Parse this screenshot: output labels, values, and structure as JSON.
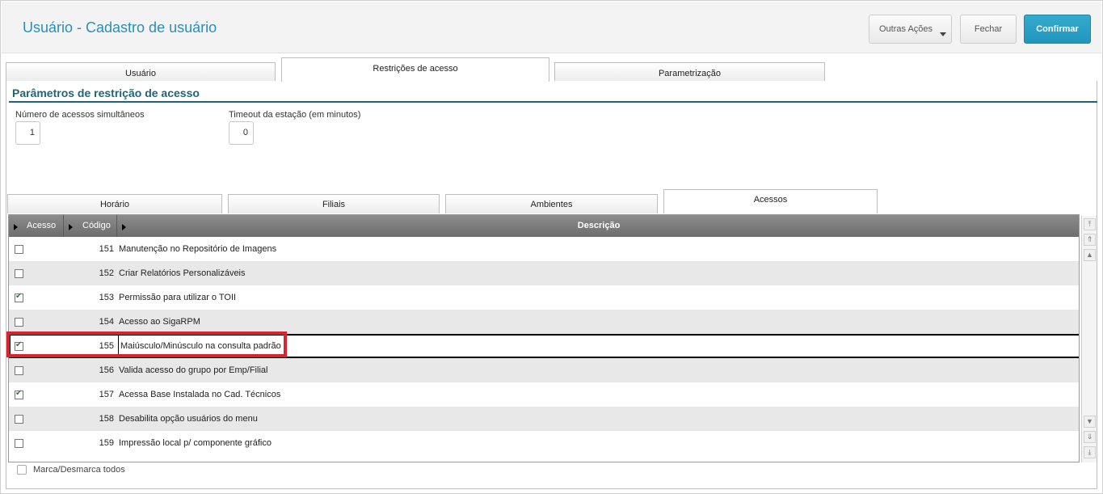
{
  "header": {
    "title": "Usuário - Cadastro de usuário",
    "btn_outras": "Outras Ações",
    "btn_fechar": "Fechar",
    "btn_confirmar": "Confirmar",
    "accent_color": "#2b8fb8"
  },
  "tabs": [
    {
      "label": "Usuário",
      "active": false
    },
    {
      "label": "Restrições de acesso",
      "active": true
    },
    {
      "label": "Parametrização",
      "active": false
    }
  ],
  "section": {
    "title": "Parâmetros de restrição de acesso",
    "fields": [
      {
        "label": "Número de acessos simultâneos",
        "value": "1"
      },
      {
        "label": "Timeout da estação (em minutos)",
        "value": "0"
      }
    ]
  },
  "subtabs": [
    {
      "label": "Horário",
      "active": false
    },
    {
      "label": "Filiais",
      "active": false
    },
    {
      "label": "Ambientes",
      "active": false
    },
    {
      "label": "Acessos",
      "active": true
    }
  ],
  "grid": {
    "columns": [
      "Acesso",
      "Código",
      "Descrição"
    ],
    "rows": [
      {
        "checked": false,
        "code": "151",
        "desc": "Manutenção no Repositório de Imagens"
      },
      {
        "checked": false,
        "code": "152",
        "desc": "Criar Relatórios Personalizáveis"
      },
      {
        "checked": true,
        "code": "153",
        "desc": "Permissão para utilizar o TOII"
      },
      {
        "checked": false,
        "code": "154",
        "desc": "Acesso ao SigaRPM"
      },
      {
        "checked": true,
        "code": "155",
        "desc": "Maiúsculo/Minúsculo na consulta padrão",
        "selected": true
      },
      {
        "checked": false,
        "code": "156",
        "desc": "Valida acesso do grupo por Emp/Filial"
      },
      {
        "checked": true,
        "code": "157",
        "desc": "Acessa Base Instalada no Cad. Técnicos"
      },
      {
        "checked": false,
        "code": "158",
        "desc": "Desabilita opção usuários do menu"
      },
      {
        "checked": false,
        "code": "159",
        "desc": "Impressão local p/ componente gráfico"
      }
    ]
  },
  "footer": {
    "toggle_all_label": "Marca/Desmarca todos"
  }
}
